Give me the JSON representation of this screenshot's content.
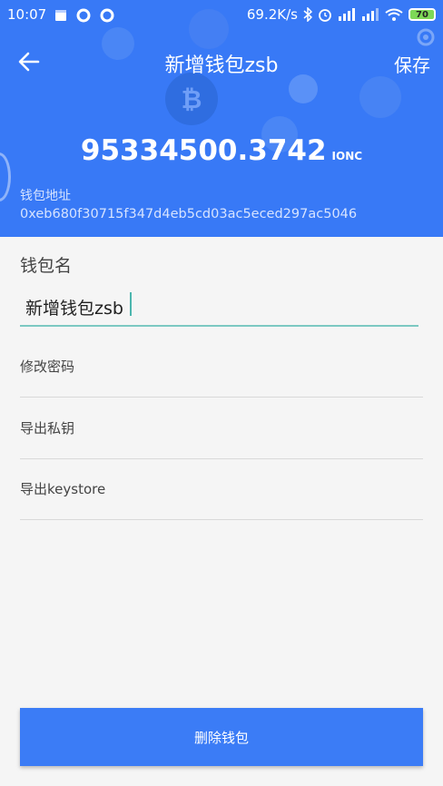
{
  "status_bar": {
    "time": "10:07",
    "speed": "69.2K/s",
    "battery": "70"
  },
  "header": {
    "title": "新增钱包zsb",
    "save_label": "保存",
    "balance": "95334500.3742",
    "unit": "IONC",
    "address_label": "钱包地址",
    "address": "0xeb680f30715f347d4eb5cd03ac5eced297ac5046"
  },
  "form": {
    "name_label": "钱包名",
    "name_value": "新增钱包zsb"
  },
  "menu": [
    {
      "label": "修改密码"
    },
    {
      "label": "导出私钥"
    },
    {
      "label": "导出keystore"
    }
  ],
  "footer": {
    "delete_label": "删除钱包"
  },
  "colors": {
    "header_bg": "#3879f6",
    "input_underline": "#7cc8c2",
    "button_bg": "#3b7cf6",
    "page_bg": "#f5f5f5"
  }
}
